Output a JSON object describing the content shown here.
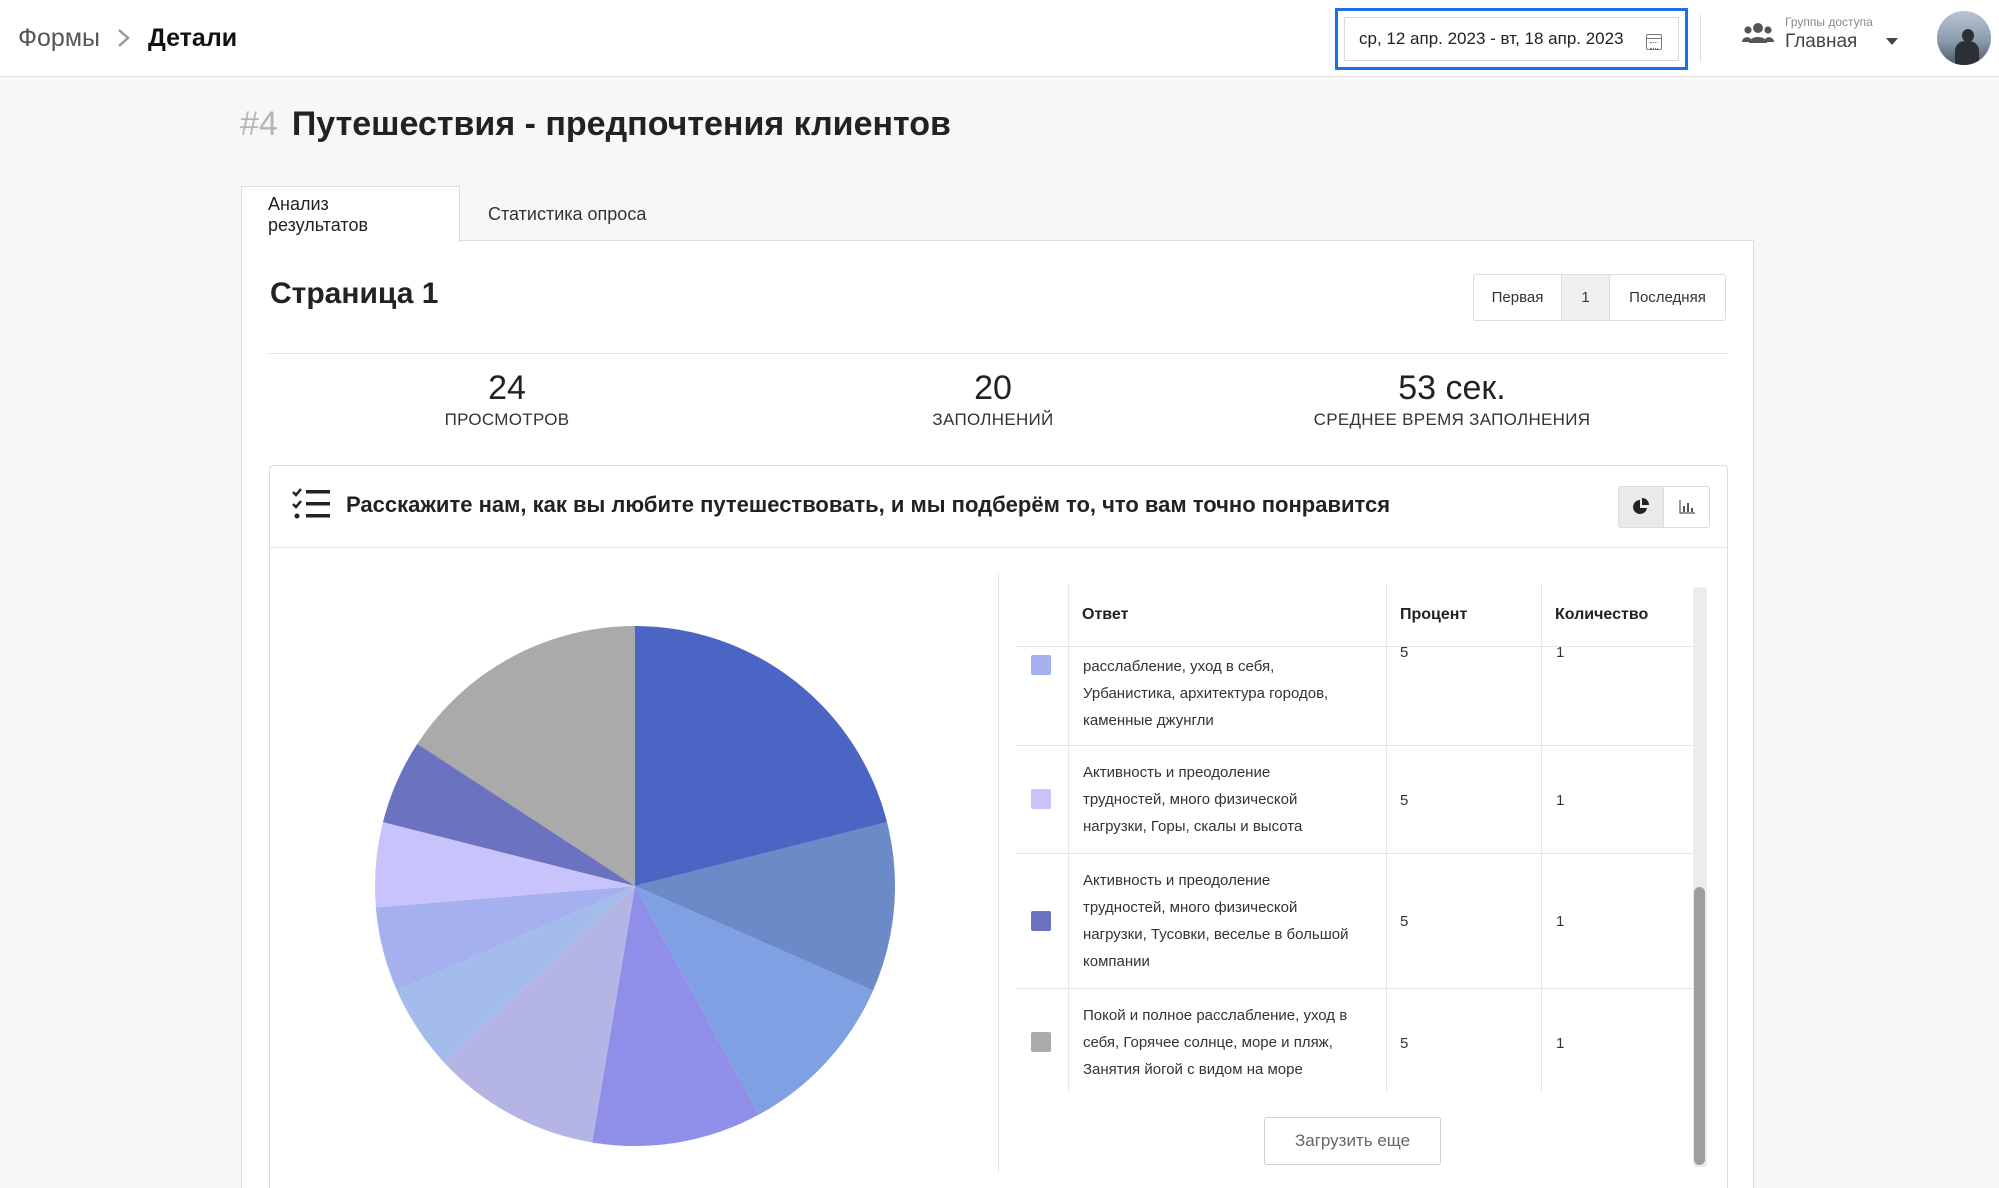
{
  "breadcrumb": {
    "root": "Формы",
    "current": "Детали"
  },
  "date_range": "ср, 12 апр. 2023 - вт, 18 апр. 2023",
  "access_group": {
    "label": "Группы доступа",
    "value": "Главная"
  },
  "form": {
    "number": "#4",
    "title": "Путешествия - предпочтения клиентов"
  },
  "tabs": [
    {
      "label": "Анализ результатов",
      "active": true
    },
    {
      "label": "Статистика опроса",
      "active": false
    }
  ],
  "page": {
    "heading": "Страница 1",
    "pager": {
      "first": "Первая",
      "current": "1",
      "last": "Последняя"
    }
  },
  "stats": [
    {
      "value": "24",
      "label": "ПРОСМОТРОВ"
    },
    {
      "value": "20",
      "label": "ЗАПОЛНЕНИЙ"
    },
    {
      "value": "53 сек.",
      "label": "СРЕДНЕЕ ВРЕМЯ ЗАПОЛНЕНИЯ"
    }
  ],
  "question": {
    "text": "Расскажите нам, как вы любите путешествовать, и мы подберём то, что вам точно понравится",
    "view_icons": [
      "pie-chart-icon",
      "bar-chart-icon"
    ]
  },
  "table": {
    "headers": {
      "answer": "Ответ",
      "percent": "Процент",
      "count": "Количество"
    },
    "rows": [
      {
        "color": "#a4b1ee",
        "answer": [
          "расслабление, уход в себя,",
          "Урбанистика, архитектура городов,",
          "каменные джунгли"
        ],
        "percent": "5",
        "count": "1"
      },
      {
        "color": "#c9c3fb",
        "answer": [
          "Активность и преодоление",
          "трудностей, много физической",
          "нагрузки, Горы, скалы и высота"
        ],
        "percent": "5",
        "count": "1"
      },
      {
        "color": "#6b73c1",
        "answer": [
          "Активность и преодоление",
          "трудностей, много физической",
          "нагрузки, Тусовки, веселье в большой",
          "компании"
        ],
        "percent": "5",
        "count": "1"
      },
      {
        "color": "#aaaaaa",
        "answer": [
          "Покой и полное расслабление, уход в",
          "себя, Горячее солнце, море и пляж,",
          "Занятия йогой с видом на море"
        ],
        "percent": "5",
        "count": "1"
      }
    ],
    "load_more": "Загрузить еще"
  },
  "chart_data": {
    "type": "pie",
    "unit": "%",
    "slices": [
      {
        "value": 20,
        "color": "#4a65c3"
      },
      {
        "value": 10,
        "color": "#6c8ac8"
      },
      {
        "value": 10,
        "color": "#7fa0e2"
      },
      {
        "value": 10,
        "color": "#8f8fea"
      },
      {
        "value": 10,
        "color": "#b5b5e5"
      },
      {
        "value": 5,
        "color": "#a3bceb"
      },
      {
        "value": 5,
        "color": "#a4b1ee"
      },
      {
        "value": 5,
        "color": "#c9c3fb"
      },
      {
        "value": 5,
        "color": "#6b73c1"
      },
      {
        "value": 15,
        "color": "#aaaaaa"
      }
    ]
  }
}
